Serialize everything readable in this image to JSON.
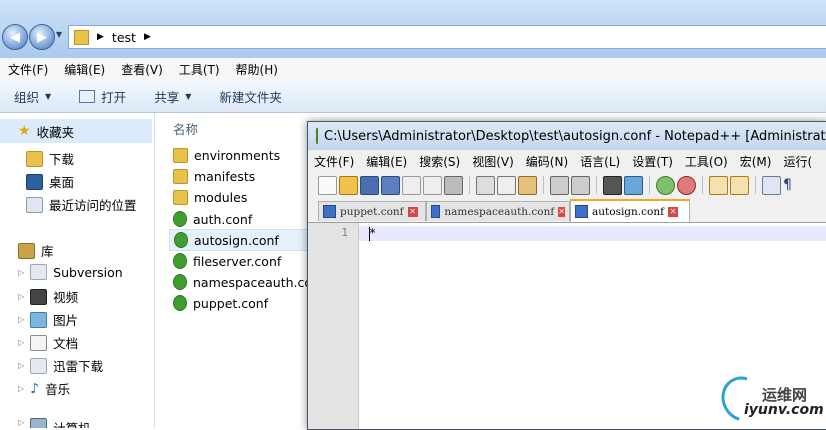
{
  "explorer": {
    "path": "test",
    "menu": [
      "文件(F)",
      "编辑(E)",
      "查看(V)",
      "工具(T)",
      "帮助(H)"
    ],
    "toolbar": {
      "organize": "组织",
      "open": "打开",
      "share": "共享",
      "new_folder": "新建文件夹"
    },
    "column_header": "名称",
    "nav": {
      "favorites": "收藏夹",
      "favorites_items": [
        "下载",
        "桌面",
        "最近访问的位置"
      ],
      "libraries": "库",
      "library_items": [
        "Subversion",
        "视频",
        "图片",
        "文档",
        "迅雷下载",
        "音乐"
      ],
      "computer_partial": "计算机"
    },
    "files": [
      "environments",
      "manifests",
      "modules",
      "auth.conf",
      "autosign.conf",
      "fileserver.conf",
      "namespaceauth.conf",
      "puppet.conf"
    ]
  },
  "notepad": {
    "title": "C:\\Users\\Administrator\\Desktop\\test\\autosign.conf - Notepad++ [Administrator]",
    "menu": [
      "文件(F)",
      "编辑(E)",
      "搜索(S)",
      "视图(V)",
      "编码(N)",
      "语言(L)",
      "设置(T)",
      "工具(O)",
      "宏(M)",
      "运行("
    ],
    "tabs": [
      "puppet.conf",
      "namespaceauth.conf",
      "autosign.conf"
    ],
    "active_tab": 2,
    "line_number": "1",
    "line_content": "*"
  },
  "watermark": {
    "cn": "运维网",
    "url": "iyunv.com"
  }
}
